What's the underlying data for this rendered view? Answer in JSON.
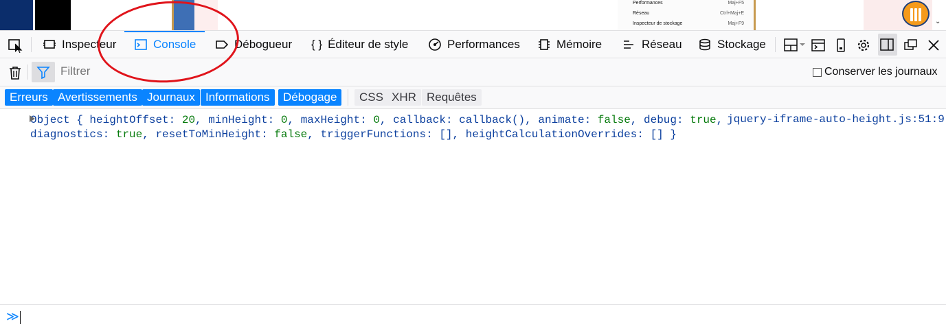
{
  "page_strip": {
    "menu_items": [
      {
        "label": "Performances",
        "shortcut": "Maj+F5"
      },
      {
        "label": "Réseau",
        "shortcut": "Ctrl+Maj+E"
      },
      {
        "label": "Inspecteur de stockage",
        "shortcut": "Maj+F9"
      }
    ]
  },
  "toolbar": {
    "tabs": [
      {
        "label": "Inspecteur",
        "icon": "inspector-icon"
      },
      {
        "label": "Console",
        "icon": "console-icon",
        "selected": true
      },
      {
        "label": "Débogueur",
        "icon": "debugger-icon"
      },
      {
        "label": "Éditeur de style",
        "icon_text": "{ }"
      },
      {
        "label": "Performances",
        "icon": "performance-icon"
      },
      {
        "label": "Mémoire",
        "icon": "memory-icon"
      },
      {
        "label": "Réseau",
        "icon": "network-icon"
      },
      {
        "label": "Stockage",
        "icon": "storage-icon"
      }
    ]
  },
  "filter": {
    "placeholder": "Filtrer",
    "persist_label": "Conserver les journaux"
  },
  "categories": {
    "levels": [
      "Erreurs",
      "Avertissements",
      "Journaux",
      "Informations",
      "Débogage"
    ],
    "types": [
      "CSS",
      "XHR",
      "Requêtes"
    ]
  },
  "console_message": {
    "object_label": "Object",
    "tokens": [
      {
        "k": "heightOffset",
        "v": "20",
        "t": "num"
      },
      {
        "k": "minHeight",
        "v": "0",
        "t": "num"
      },
      {
        "k": "maxHeight",
        "v": "0",
        "t": "num"
      },
      {
        "k": "callback",
        "v": "callback()",
        "t": "obj"
      },
      {
        "k": "animate",
        "v": "false",
        "t": "bool"
      },
      {
        "k": "debug",
        "v": "true",
        "t": "bool"
      },
      {
        "k": "diagnostics",
        "v": "true",
        "t": "bool"
      },
      {
        "k": "resetToMinHeight",
        "v": "false",
        "t": "bool"
      },
      {
        "k": "triggerFunctions",
        "v": "[]",
        "t": "obj"
      },
      {
        "k": "heightCalculationOverrides",
        "v": "[]",
        "t": "obj"
      }
    ],
    "source": "jquery-iframe-auto-height.js",
    "location": ":51:9"
  },
  "input": {
    "prompt": "≫"
  },
  "colors": {
    "accent": "#0a84ff",
    "annotation": "#e0141b"
  }
}
